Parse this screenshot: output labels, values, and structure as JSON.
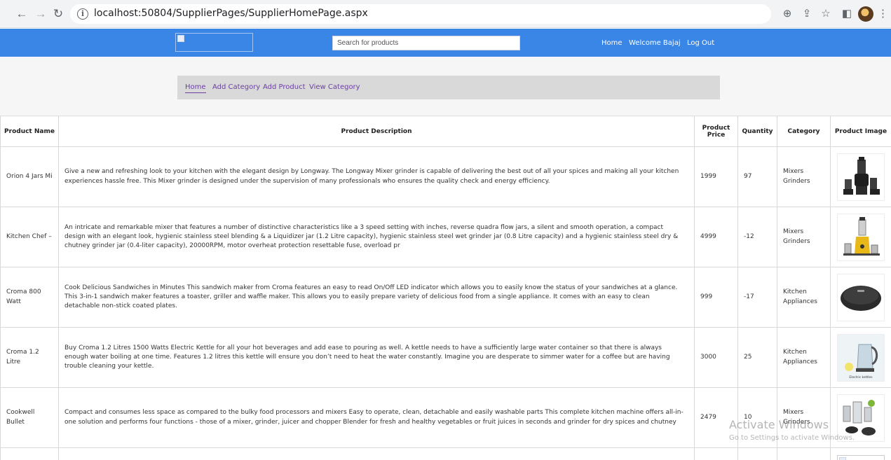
{
  "browser": {
    "url": "localhost:50804/SupplierPages/SupplierHomePage.aspx",
    "back_icon": "arrow-left-icon",
    "forward_icon": "arrow-right-icon",
    "reload_icon": "reload-icon"
  },
  "header": {
    "search_placeholder": "Search for products",
    "home_label": "Home",
    "welcome_label": "Welcome Bajaj",
    "logout_label": "Log Out",
    "bar_color": "#3a86e6"
  },
  "subnav": {
    "items": [
      {
        "label": "Home"
      },
      {
        "label": "Add Category"
      },
      {
        "label": "Add Product"
      },
      {
        "label": "View Category"
      }
    ]
  },
  "table": {
    "columns": [
      "Product Name",
      "Product Description",
      "Product Price",
      "Quantity",
      "Category",
      "Product Image"
    ],
    "rows": [
      {
        "name": "Orion 4 Jars Mi",
        "description": "Give a new and refreshing look to your kitchen with the elegant design by Longway. The Longway Mixer grinder is capable of delivering the best out of all your spices and making all your kitchen experiences hassle free. This Mixer grinder is designed under the supervision of many professionals who ensures the quality check and energy efficiency.",
        "price": "1999",
        "quantity": "97",
        "category": "Mixers Grinders",
        "image_icon": "mixer-grinder-image"
      },
      {
        "name": "Kitchen Chef –",
        "description": "An intricate and remarkable mixer that features a number of distinctive characteristics like a 3 speed setting with inches, reverse quadra flow jars, a silent and smooth operation, a compact design with an elegant look, hygienic stainless steel blending & a Liquidizer jar (1.2 Litre capacity), hygienic stainless steel wet grinder jar (0.8 Litre capacity) and a hygienic stainless steel dry & chutney grinder jar (0.4-liter capacity), 20000RPM, motor overheat protection resettable fuse, overload pr",
        "price": "4999",
        "quantity": "-12",
        "category": "Mixers Grinders",
        "image_icon": "yellow-mixer-image"
      },
      {
        "name": "Croma 800 Watt",
        "description": "Cook Delicious Sandwiches in Minutes This sandwich maker from Croma features an easy to read On/Off LED indicator which allows you to easily know the status of your sandwiches at a glance. This 3-in-1 sandwich maker features a toaster, griller and waffle maker. This allows you to easily prepare variety of delicious food from a single appliance. It comes with an easy to clean detachable non-stick coated plates.",
        "price": "999",
        "quantity": "-17",
        "category": "Kitchen Appliances",
        "image_icon": "sandwich-maker-image"
      },
      {
        "name": "Croma 1.2 Litre",
        "description": "Buy Croma 1.2 Litres 1500 Watts Electric Kettle for all your hot beverages and add ease to pouring as well. A kettle needs to have a sufficiently large water container so that there is always enough water boiling at one time. Features 1.2 litres this kettle will ensure you don’t need to heat the water constantly. Imagine you are desperate to simmer water for a coffee but are having trouble cleaning your kettle.",
        "price": "3000",
        "quantity": "25",
        "category": "Kitchen Appliances",
        "image_icon": "electric-kettle-image",
        "image_caption": "Electric kettles"
      },
      {
        "name": "Cookwell Bullet",
        "description": "Compact and consumes less space as compared to the bulky food processors and mixers Easy to operate, clean, detachable and easily washable parts This complete kitchen machine offers all-in-one solution and performs four functions - those of a mixer, grinder, juicer and chopper Blender for fresh and healthy vegetables or fruit juices in seconds and grinder for dry spices and chutney",
        "price": "2479",
        "quantity": "10",
        "category": "Mixers Grinders",
        "image_icon": "bullet-blender-image"
      }
    ]
  },
  "watermark": {
    "title": "Activate Windows",
    "subtitle": "Go to Settings to activate Windows."
  }
}
